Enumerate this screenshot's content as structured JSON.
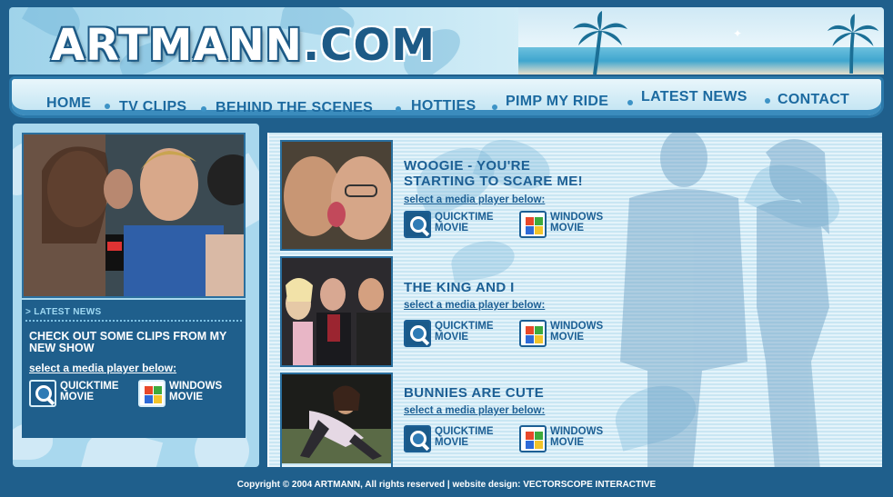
{
  "header": {
    "logo_main": "ARTMANN",
    "logo_domain": ".COM"
  },
  "nav": {
    "items": [
      {
        "label": "HOME"
      },
      {
        "label": "TV CLIPS"
      },
      {
        "label": "BEHIND THE SCENES"
      },
      {
        "label": "HOTTIES"
      },
      {
        "label": "PIMP MY RIDE"
      },
      {
        "label": "LATEST NEWS"
      },
      {
        "label": "CONTACT"
      }
    ]
  },
  "sidebar": {
    "news_header": "> LATEST NEWS",
    "news_text": "CHECK OUT SOME CLIPS FROM MY NEW SHOW",
    "select_label": "select a media player below:",
    "quicktime_line1": "QUICKTIME",
    "quicktime_line2": "MOVIE",
    "windows_line1": "WINDOWS",
    "windows_line2": "MOVIE"
  },
  "clips": [
    {
      "title_line1": "WOOGIE - YOU'RE",
      "title_line2": "STARTING TO SCARE ME!",
      "select_label": "select a media player below:",
      "quicktime_line1": "QUICKTIME",
      "quicktime_line2": "MOVIE",
      "windows_line1": "WINDOWS",
      "windows_line2": "MOVIE"
    },
    {
      "title_line1": "THE KING AND I",
      "title_line2": "",
      "select_label": "select a media player below:",
      "quicktime_line1": "QUICKTIME",
      "quicktime_line2": "MOVIE",
      "windows_line1": "WINDOWS",
      "windows_line2": "MOVIE"
    },
    {
      "title_line1": "BUNNIES ARE CUTE",
      "title_line2": "",
      "select_label": "select a media player below:",
      "quicktime_line1": "QUICKTIME",
      "quicktime_line2": "MOVIE",
      "windows_line1": "WINDOWS",
      "windows_line2": "MOVIE"
    }
  ],
  "footer": {
    "copyright": "Copyright © 2004 ARTMANN, All rights reserved | website design: ",
    "designer": "VECTORSCOPE INTERACTIVE"
  },
  "icons": {
    "quicktime": "quicktime-icon",
    "windows": "windows-media-icon"
  },
  "colors": {
    "background": "#1f5f8c",
    "nav_text": "#1c6aa0",
    "title_text": "#1c5f94",
    "panel_light": "#a9d8ee"
  }
}
